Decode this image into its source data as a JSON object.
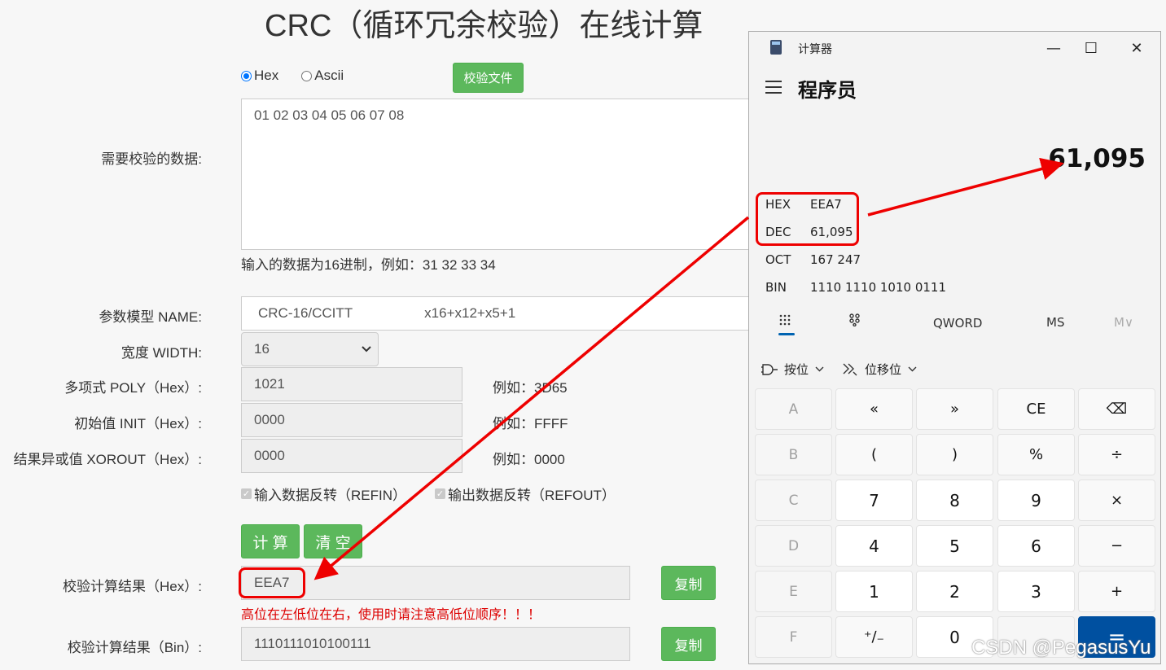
{
  "page": {
    "title": "CRC（循环冗余校验）在线计算",
    "radio_hex": "Hex",
    "radio_ascii": "Ascii",
    "file_btn": "校验文件",
    "data_label": "需要校验的数据:",
    "data_value": "01 02 03 04 05 06 07 08",
    "data_hint": "输入的数据为16进制，例如：31 32 33 34",
    "model_label": "参数模型 NAME:",
    "model_value": "CRC-16/CCITT",
    "model_poly": "x16+x12+x5+1",
    "width_label": "宽度 WIDTH:",
    "width_value": "16",
    "poly_label": "多项式 POLY（Hex）:",
    "poly_value": "1021",
    "poly_example": "例如：3D65",
    "init_label": "初始值 INIT（Hex）:",
    "init_value": "0000",
    "init_example": "例如：FFFF",
    "xorout_label": "结果异或值 XOROUT（Hex）:",
    "xorout_value": "0000",
    "xorout_example": "例如：0000",
    "refin": "输入数据反转（REFIN）",
    "refout": "输出数据反转（REFOUT）",
    "calc_btn": "计 算",
    "clear_btn": "清 空",
    "result_hex_label": "校验计算结果（Hex）:",
    "result_hex_value": "EEA7",
    "copy_btn": "复制",
    "warning": "高位在左低位在右，使用时请注意高低位顺序！！！",
    "result_bin_label": "校验计算结果（Bin）:",
    "result_bin_value": "1110111010100111"
  },
  "calculator": {
    "window_title": "计算器",
    "mode": "程序员",
    "display": "61,095",
    "radix": [
      {
        "key": "HEX",
        "value": "EEA7"
      },
      {
        "key": "DEC",
        "value": "61,095"
      },
      {
        "key": "OCT",
        "value": "167 247"
      },
      {
        "key": "BIN",
        "value": "1110 1110 1010 0111"
      }
    ],
    "word_size": "QWORD",
    "ms": "MS",
    "mv": "M∨",
    "bitwise": "按位",
    "bitshift": "位移位",
    "keys": [
      [
        "A",
        "«",
        "»",
        "CE",
        "⌫"
      ],
      [
        "B",
        "(",
        ")",
        "%",
        "÷"
      ],
      [
        "C",
        "7",
        "8",
        "9",
        "×"
      ],
      [
        "D",
        "4",
        "5",
        "6",
        "−"
      ],
      [
        "E",
        "1",
        "2",
        "3",
        "+"
      ],
      [
        "F",
        "⁺∕₋",
        "0",
        "",
        "="
      ]
    ]
  },
  "watermark": "CSDN @PegasusYu"
}
